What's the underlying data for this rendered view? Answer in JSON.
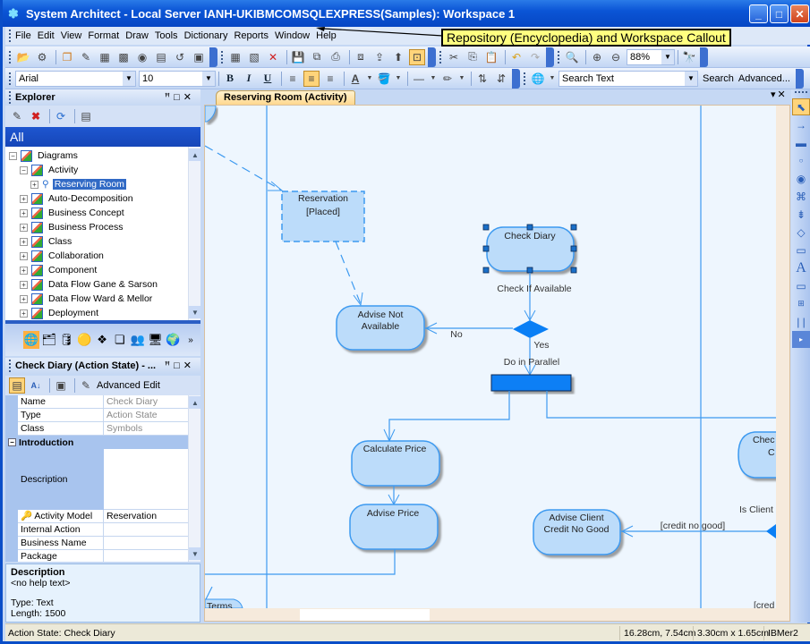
{
  "window": {
    "title": "System Architect - Local Server IANH-UKIBMCOMSQLEXPRESS(Samples): Workspace 1",
    "controls": [
      "minimize",
      "maximize",
      "close"
    ]
  },
  "callout": {
    "text": "Repository (Encyclopedia) and Workspace Callout"
  },
  "menu": [
    "File",
    "Edit",
    "View",
    "Format",
    "Draw",
    "Tools",
    "Dictionary",
    "Reports",
    "Window",
    "Help"
  ],
  "toolbar": {
    "zoom_value": "88%",
    "font_name": "Arial",
    "font_size": "10",
    "bold": "B",
    "italic": "I",
    "underline": "U",
    "search_placeholder": "Search Text",
    "search_label": "Search",
    "advanced_label": "Advanced..."
  },
  "explorer": {
    "title": "Explorer",
    "scope": "All",
    "tree": [
      {
        "label": "Diagrams",
        "level": 0,
        "expanded": true
      },
      {
        "label": "Activity",
        "level": 1,
        "expanded": true
      },
      {
        "label": "Reserving Room",
        "level": 2,
        "selected": true
      },
      {
        "label": "Auto-Decomposition",
        "level": 1
      },
      {
        "label": "Business Concept",
        "level": 1
      },
      {
        "label": "Business Process",
        "level": 1
      },
      {
        "label": "Class",
        "level": 1
      },
      {
        "label": "Collaboration",
        "level": 1
      },
      {
        "label": "Component",
        "level": 1
      },
      {
        "label": "Data Flow Gane & Sarson",
        "level": 1
      },
      {
        "label": "Data Flow Ward & Mellor",
        "level": 1
      },
      {
        "label": "Deployment",
        "level": 1
      }
    ]
  },
  "properties": {
    "title": "Check Diary (Action State) - ...",
    "advanced_edit": "Advanced Edit",
    "rows": [
      {
        "name": "Name",
        "value": "Check Diary",
        "readonly": true
      },
      {
        "name": "Type",
        "value": "Action State",
        "readonly": true
      },
      {
        "name": "Class",
        "value": "Symbols",
        "readonly": true
      }
    ],
    "section": "Introduction",
    "description_label": "Description",
    "rows2": [
      {
        "name": "Activity Model",
        "value": "Reservation"
      },
      {
        "name": "Internal Action",
        "value": ""
      },
      {
        "name": "Business Name",
        "value": ""
      },
      {
        "name": "Package",
        "value": ""
      }
    ]
  },
  "description_panel": {
    "title": "Description",
    "help": "<no help text>",
    "type": "Type:  Text",
    "length": "Length:  1500"
  },
  "document_tab": {
    "label": "Reserving Room (Activity)"
  },
  "diagram": {
    "nodes": {
      "reservation": [
        "Reservation",
        "[Placed]"
      ],
      "check_diary": "Check Diary",
      "advise_not_available": [
        "Advise Not",
        "Available"
      ],
      "calculate_price": "Calculate Price",
      "advise_price": "Advise Price",
      "advise_client_credit": [
        "Advise Client",
        "Credit No Good"
      ],
      "check_credit_partial": [
        "Chec",
        "C"
      ],
      "terms_partial": "Terms"
    },
    "labels": {
      "check_if_available": "Check If Available",
      "no": "No",
      "yes": "Yes",
      "do_in_parallel": "Do in Parallel",
      "credit_no_good": "[credit no good]",
      "is_client": "Is Client",
      "cred_partial": "[cred"
    }
  },
  "status": {
    "left": "Action State: Check Diary",
    "position": "16.28cm, 7.54cm",
    "size": "3.30cm x 1.65cm",
    "user": "IBMer2"
  }
}
